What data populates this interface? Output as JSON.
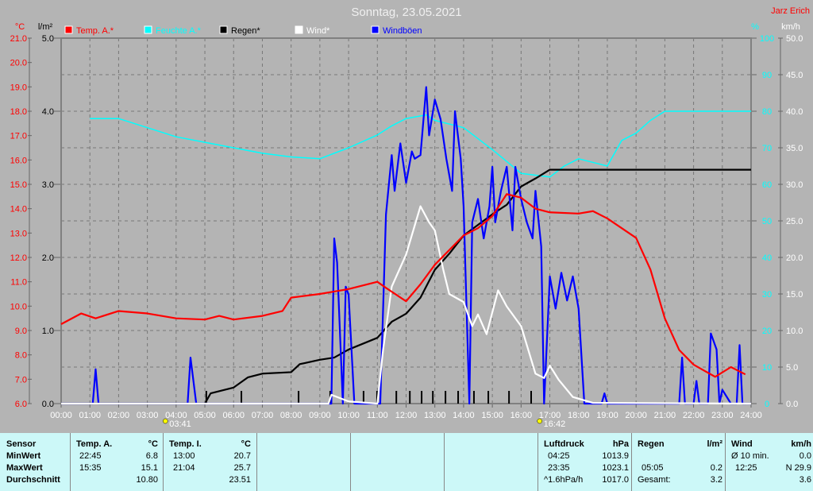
{
  "chart_data": {
    "type": "line",
    "title": "Sonntag, 23.05.2021",
    "author": "Jarz Erich",
    "legend": [
      {
        "name": "Temp. A.*",
        "color": "#ff0000"
      },
      {
        "name": "Feuchte A.*",
        "color": "#00ffff"
      },
      {
        "name": "Regen*",
        "color": "#000000"
      },
      {
        "name": "Wind*",
        "color": "#ffffff"
      },
      {
        "name": "Windböen",
        "color": "#0000ff"
      }
    ],
    "axes": {
      "temp": {
        "unit": "°C",
        "range": [
          6,
          21
        ],
        "ticks": [
          "6.0",
          "7.0",
          "8.0",
          "9.0",
          "10.0",
          "11.0",
          "12.0",
          "13.0",
          "14.0",
          "15.0",
          "16.0",
          "17.0",
          "18.0",
          "19.0",
          "20.0",
          "21.0"
        ]
      },
      "rain": {
        "unit": "l/m²",
        "range": [
          0,
          5
        ],
        "ticks": [
          "0.0",
          "1.0",
          "2.0",
          "3.0",
          "4.0",
          "5.0"
        ]
      },
      "humidity": {
        "unit": "%",
        "range": [
          0,
          100
        ],
        "ticks": [
          "0",
          "10",
          "20",
          "30",
          "40",
          "50",
          "60",
          "70",
          "80",
          "90",
          "100"
        ]
      },
      "wind": {
        "unit": "km/h",
        "range": [
          0,
          50
        ],
        "ticks": [
          "0.0",
          "5.0",
          "10.0",
          "15.0",
          "20.0",
          "25.0",
          "30.0",
          "35.0",
          "40.0",
          "45.0",
          "50.0"
        ]
      },
      "x": {
        "range": [
          0,
          24
        ],
        "ticks": [
          "00:00",
          "01:00",
          "02:00",
          "03:00",
          "04:00",
          "05:00",
          "06:00",
          "07:00",
          "08:00",
          "09:00",
          "10:00",
          "11:00",
          "12:00",
          "13:00",
          "14:00",
          "15:00",
          "16:00",
          "17:00",
          "18:00",
          "19:00",
          "20:00",
          "21:00",
          "22:00",
          "23:00",
          "24:00"
        ]
      }
    },
    "sunrise": {
      "time": "03:41",
      "hour": 3.68
    },
    "sunset": {
      "time": "16:42",
      "hour": 16.7
    },
    "series": [
      {
        "name": "Temp. A.",
        "axis": "temp",
        "color": "#ff0000",
        "points": [
          [
            0,
            9.26
          ],
          [
            0.7,
            9.7
          ],
          [
            1.2,
            9.5
          ],
          [
            2,
            9.8
          ],
          [
            3,
            9.7
          ],
          [
            4,
            9.5
          ],
          [
            5,
            9.45
          ],
          [
            5.5,
            9.6
          ],
          [
            6,
            9.45
          ],
          [
            7,
            9.6
          ],
          [
            7.7,
            9.8
          ],
          [
            8,
            10.35
          ],
          [
            9,
            10.5
          ],
          [
            9.5,
            10.6
          ],
          [
            10,
            10.7
          ],
          [
            11,
            11.0
          ],
          [
            11.3,
            10.75
          ],
          [
            12,
            10.2
          ],
          [
            12.5,
            10.9
          ],
          [
            13,
            11.7
          ],
          [
            14,
            12.9
          ],
          [
            14.5,
            13.2
          ],
          [
            15,
            13.7
          ],
          [
            15.5,
            14.6
          ],
          [
            16,
            14.45
          ],
          [
            16.5,
            14.0
          ],
          [
            17,
            13.85
          ],
          [
            18,
            13.8
          ],
          [
            18.5,
            13.9
          ],
          [
            19,
            13.6
          ],
          [
            20,
            12.8
          ],
          [
            20.5,
            11.5
          ],
          [
            21,
            9.5
          ],
          [
            21.5,
            8.2
          ],
          [
            22,
            7.6
          ],
          [
            22.75,
            7.1
          ],
          [
            23.3,
            7.5
          ],
          [
            23.8,
            7.2
          ]
        ]
      },
      {
        "name": "Feuchte A.",
        "axis": "humidity",
        "color": "#00ffff",
        "points": [
          [
            1,
            78
          ],
          [
            2,
            78
          ],
          [
            3,
            75.5
          ],
          [
            4,
            73
          ],
          [
            5,
            71.5
          ],
          [
            6,
            70
          ],
          [
            7,
            68.5
          ],
          [
            8,
            67.5
          ],
          [
            9,
            67
          ],
          [
            10,
            70
          ],
          [
            11,
            73.5
          ],
          [
            11.5,
            76
          ],
          [
            12,
            78
          ],
          [
            12.7,
            79
          ],
          [
            13,
            77.5
          ],
          [
            14,
            75.5
          ],
          [
            15,
            69.5
          ],
          [
            16,
            63
          ],
          [
            17,
            62
          ],
          [
            17.5,
            65
          ],
          [
            18,
            67
          ],
          [
            19,
            65
          ],
          [
            19.5,
            72
          ],
          [
            20,
            74
          ],
          [
            20.5,
            77.5
          ],
          [
            21,
            80
          ],
          [
            24,
            80
          ]
        ]
      },
      {
        "name": "Regen",
        "axis": "rain",
        "color": "#000000",
        "points": [
          [
            0,
            0
          ],
          [
            5,
            0
          ],
          [
            5.2,
            0.14
          ],
          [
            6,
            0.22
          ],
          [
            6.5,
            0.36
          ],
          [
            7,
            0.41
          ],
          [
            8,
            0.43
          ],
          [
            8.3,
            0.54
          ],
          [
            9,
            0.6
          ],
          [
            9.5,
            0.63
          ],
          [
            10,
            0.74
          ],
          [
            11,
            0.9
          ],
          [
            11.5,
            1.12
          ],
          [
            12,
            1.23
          ],
          [
            12.5,
            1.45
          ],
          [
            13,
            1.83
          ],
          [
            13.5,
            2.05
          ],
          [
            14,
            2.3
          ],
          [
            15,
            2.59
          ],
          [
            15.5,
            2.72
          ],
          [
            16,
            2.97
          ],
          [
            16.5,
            3.08
          ],
          [
            17,
            3.2
          ],
          [
            24,
            3.2
          ]
        ]
      },
      {
        "name": "Wind",
        "axis": "wind",
        "color": "#ffffff",
        "points": [
          [
            0,
            0
          ],
          [
            9.3,
            0
          ],
          [
            9.4,
            1.2
          ],
          [
            10,
            0.3
          ],
          [
            11,
            0
          ],
          [
            11.2,
            7.4
          ],
          [
            11.5,
            16
          ],
          [
            12,
            20.4
          ],
          [
            12.5,
            27
          ],
          [
            12.8,
            24.8
          ],
          [
            13,
            23.7
          ],
          [
            13.3,
            18.2
          ],
          [
            13.5,
            15
          ],
          [
            14,
            13.9
          ],
          [
            14.3,
            10.6
          ],
          [
            14.5,
            12.2
          ],
          [
            14.8,
            9.5
          ],
          [
            15.2,
            15.5
          ],
          [
            15.5,
            13.3
          ],
          [
            16,
            10.6
          ],
          [
            16.5,
            4.1
          ],
          [
            16.8,
            3.5
          ],
          [
            17,
            5.2
          ],
          [
            17.3,
            3.3
          ],
          [
            17.8,
            0.9
          ],
          [
            18.5,
            0.1
          ],
          [
            24,
            0
          ]
        ]
      },
      {
        "name": "Windböen",
        "axis": "wind",
        "color": "#0000ff",
        "points": [
          [
            0,
            0
          ],
          [
            1.1,
            0
          ],
          [
            1.2,
            4.7
          ],
          [
            1.3,
            0
          ],
          [
            4.4,
            0
          ],
          [
            4.5,
            6.3
          ],
          [
            4.7,
            0
          ],
          [
            9.4,
            0
          ],
          [
            9.5,
            22.6
          ],
          [
            9.6,
            19.3
          ],
          [
            9.8,
            0
          ],
          [
            9.9,
            16
          ],
          [
            10,
            14.9
          ],
          [
            10.2,
            0
          ],
          [
            11.1,
            0
          ],
          [
            11.3,
            25.9
          ],
          [
            11.5,
            34
          ],
          [
            11.6,
            29.1
          ],
          [
            11.8,
            35.6
          ],
          [
            12,
            30.2
          ],
          [
            12.2,
            34.5
          ],
          [
            12.3,
            33.5
          ],
          [
            12.5,
            34
          ],
          [
            12.7,
            43.3
          ],
          [
            12.8,
            36.7
          ],
          [
            13,
            41.6
          ],
          [
            13.2,
            38.9
          ],
          [
            13.4,
            33.5
          ],
          [
            13.6,
            29.1
          ],
          [
            13.7,
            40
          ],
          [
            13.9,
            33.5
          ],
          [
            14,
            27
          ],
          [
            14.2,
            0
          ],
          [
            14.3,
            24.8
          ],
          [
            14.5,
            28
          ],
          [
            14.7,
            22.6
          ],
          [
            14.9,
            27
          ],
          [
            15,
            32.4
          ],
          [
            15.1,
            24.8
          ],
          [
            15.3,
            29.1
          ],
          [
            15.5,
            32.4
          ],
          [
            15.7,
            23.7
          ],
          [
            15.8,
            32.4
          ],
          [
            16,
            28
          ],
          [
            16.2,
            24.8
          ],
          [
            16.4,
            22.6
          ],
          [
            16.5,
            29.1
          ],
          [
            16.7,
            21.5
          ],
          [
            16.8,
            0
          ],
          [
            17,
            17.4
          ],
          [
            17.2,
            13
          ],
          [
            17.4,
            17.9
          ],
          [
            17.6,
            14.1
          ],
          [
            17.8,
            17.4
          ],
          [
            18,
            13
          ],
          [
            18.2,
            0
          ],
          [
            18.8,
            0
          ],
          [
            18.9,
            1.4
          ],
          [
            19,
            0
          ],
          [
            21.5,
            0
          ],
          [
            21.6,
            6.3
          ],
          [
            21.7,
            0
          ],
          [
            22,
            0
          ],
          [
            22.1,
            3.1
          ],
          [
            22.2,
            0
          ],
          [
            22.5,
            0
          ],
          [
            22.6,
            9.6
          ],
          [
            22.8,
            7.4
          ],
          [
            22.9,
            0
          ],
          [
            23,
            1.9
          ],
          [
            23.3,
            0
          ],
          [
            23.5,
            0
          ],
          [
            23.6,
            8
          ],
          [
            23.7,
            0
          ],
          [
            24,
            0
          ]
        ]
      }
    ],
    "rain_events": [
      5.05,
      6.27,
      8.26,
      9.36,
      10.52,
      10.99,
      11.66,
      12.13,
      12.54,
      12.93,
      13.37,
      13.81,
      14.36,
      14.86,
      15.58,
      16.35
    ]
  },
  "table": {
    "temp_a": {
      "sensor": "Sensor",
      "header": "Temp. A.",
      "unit": "°C",
      "min_label": "MinWert",
      "max_label": "MaxWert",
      "avg_label": "Durchschnitt",
      "min_time": "22:45",
      "min": "6.8",
      "max_time": "15:35",
      "max": "15.1",
      "avg": "10.80"
    },
    "temp_i": {
      "header": "Temp. I.",
      "unit": "°C",
      "min_time": "13:00",
      "min": "20.7",
      "max_time": "21:04",
      "max": "25.7",
      "avg": "23.51"
    },
    "pressure": {
      "header": "Luftdruck",
      "unit": "hPa",
      "min_time": "04:25",
      "min": "1013.9",
      "max_time": "23:35",
      "max": "1023.1",
      "trend": "^1.6hPa/h",
      "avg": "1017.0"
    },
    "rain": {
      "header": "Regen",
      "unit": "l/m²",
      "max_time": "05:05",
      "max": "0.2",
      "total_label": "Gesamt:",
      "total": "3.2"
    },
    "wind": {
      "header": "Wind",
      "unit": "km/h",
      "avg10_label": "Ø 10 min.",
      "avg10": "0.0",
      "max_time": "12:25",
      "max": "N 29.9",
      "avg": "3.6"
    }
  }
}
